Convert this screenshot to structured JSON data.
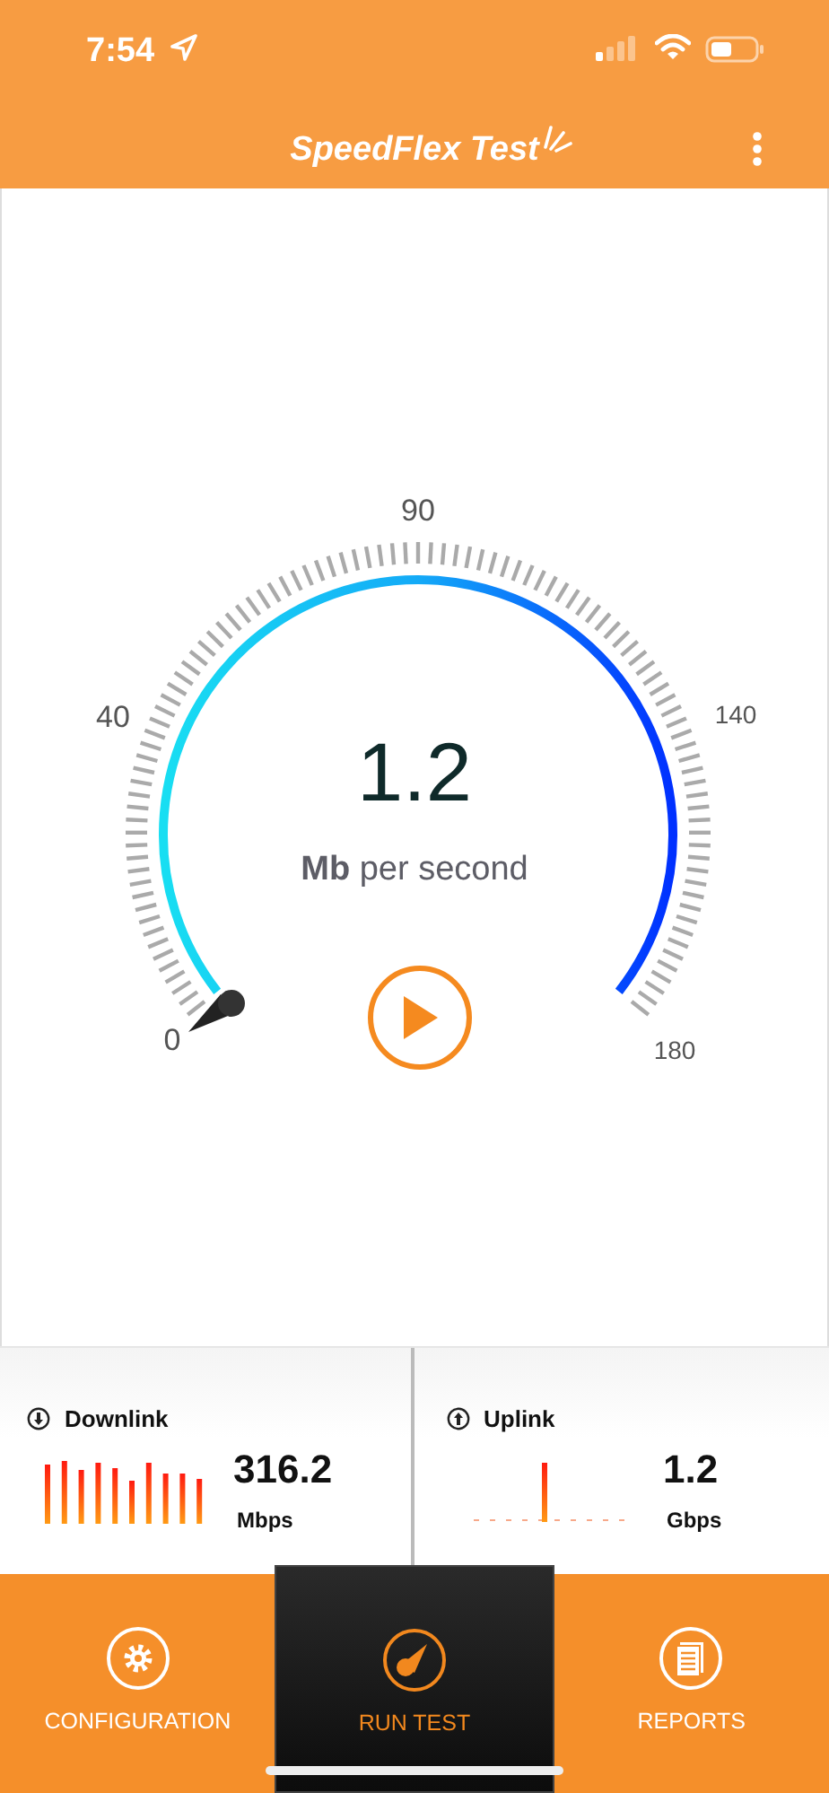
{
  "status_bar": {
    "time": "7:54"
  },
  "header": {
    "title": "SpeedFlex Test"
  },
  "gauge": {
    "scale_labels": [
      "0",
      "40",
      "90",
      "140",
      "180"
    ],
    "reading": "1.2",
    "unit": "**Mb** per second"
  },
  "stats": [
    {
      "kind": "down",
      "title": "Downlink",
      "value": "316.2",
      "unit": "Mbps"
    },
    {
      "kind": "up",
      "title": "Uplink",
      "value": "1.2",
      "unit": "Gbps"
    }
  ],
  "tabs": [
    {
      "kind": "config",
      "label": "CONFIGURATION",
      "selected": false
    },
    {
      "kind": "run",
      "label": "RUN TEST",
      "selected": true
    },
    {
      "kind": "reports",
      "label": "REPORTS",
      "selected": false
    }
  ]
}
